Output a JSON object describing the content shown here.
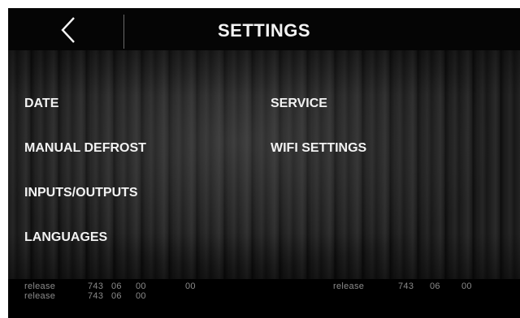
{
  "header": {
    "title": "SETTINGS",
    "back_icon": "chevron-left-icon"
  },
  "menu": {
    "left": [
      {
        "label": "DATE"
      },
      {
        "label": "MANUAL DEFROST"
      },
      {
        "label": "INPUTS/OUTPUTS"
      },
      {
        "label": "LANGUAGES"
      }
    ],
    "right": [
      {
        "label": "SERVICE"
      },
      {
        "label": "WIFI SETTINGS"
      }
    ]
  },
  "footer": {
    "left_line1": [
      "release",
      "743",
      "06",
      "00",
      "00"
    ],
    "left_line2": [
      "release",
      "743",
      "06",
      "00"
    ],
    "right_line1": [
      "release",
      "743",
      "06",
      "00"
    ]
  },
  "colors": {
    "text": "#f2f2f2",
    "release_text": "#8a8a8a",
    "background": "#000000"
  }
}
